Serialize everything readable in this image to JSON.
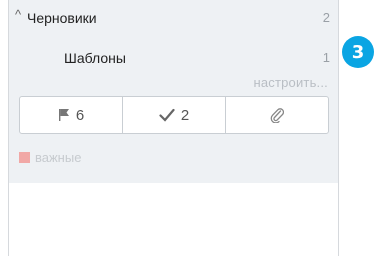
{
  "sidebar": {
    "folders": [
      {
        "label": "Черновики",
        "count": "2"
      },
      {
        "label": "Шаблоны",
        "count": "1"
      }
    ],
    "configure_link": "настроить...",
    "filters": [
      {
        "icon": "flag-icon",
        "count": "6"
      },
      {
        "icon": "checkmark-icon",
        "count": "2"
      },
      {
        "icon": "paperclip-icon",
        "count": ""
      }
    ],
    "important_label": "важные",
    "important_color": "#f1a8a6"
  },
  "step_badge": "3"
}
